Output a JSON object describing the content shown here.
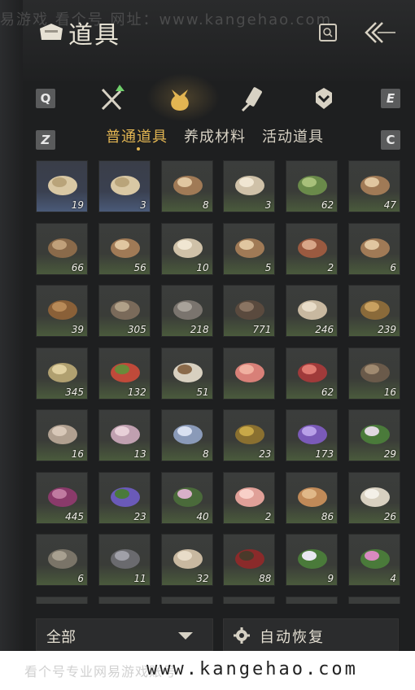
{
  "watermark_top": "易游戏 看个号  网址：www.kangehao.com",
  "header": {
    "title": "道具",
    "search_icon": "search-icon",
    "back_icon": "back-arrow-icon"
  },
  "category_keys": {
    "prev": "Q",
    "next": "E",
    "prev_sub": "Z",
    "next_sub": "C"
  },
  "categories": [
    {
      "icon": "weapons-icon",
      "active": false
    },
    {
      "icon": "pouch-icon",
      "active": true
    },
    {
      "icon": "scroll-brush-icon",
      "active": false
    },
    {
      "icon": "badge-icon",
      "active": false
    }
  ],
  "subtabs": [
    "普通道具",
    "养成材料",
    "活动道具"
  ],
  "active_subtab": 0,
  "items": [
    {
      "name": "scroll",
      "count": "19",
      "style": "blue"
    },
    {
      "name": "scroll",
      "count": "3",
      "style": "blue"
    },
    {
      "name": "logs",
      "count": "8"
    },
    {
      "name": "logs-light",
      "count": "3"
    },
    {
      "name": "bamboo",
      "count": "62"
    },
    {
      "name": "logs",
      "count": "47"
    },
    {
      "name": "branches",
      "count": "66"
    },
    {
      "name": "logs",
      "count": "56"
    },
    {
      "name": "logs-light",
      "count": "10"
    },
    {
      "name": "logs",
      "count": "5"
    },
    {
      "name": "logs-red",
      "count": "2"
    },
    {
      "name": "logs",
      "count": "6"
    },
    {
      "name": "bark",
      "count": "39"
    },
    {
      "name": "logs-dark",
      "count": "305"
    },
    {
      "name": "stone",
      "count": "218"
    },
    {
      "name": "feather",
      "count": "771"
    },
    {
      "name": "mushroom-slices",
      "count": "246"
    },
    {
      "name": "shrimp",
      "count": "239"
    },
    {
      "name": "fish",
      "count": "345"
    },
    {
      "name": "berries",
      "count": "132"
    },
    {
      "name": "mushrooms",
      "count": "51"
    },
    {
      "name": "meat",
      "count": ""
    },
    {
      "name": "meat-slab",
      "count": "62"
    },
    {
      "name": "feathers",
      "count": "16"
    },
    {
      "name": "hide",
      "count": "16"
    },
    {
      "name": "intestine",
      "count": "13"
    },
    {
      "name": "fish-blue",
      "count": "8"
    },
    {
      "name": "ore-gold",
      "count": "23"
    },
    {
      "name": "crystal",
      "count": "173"
    },
    {
      "name": "herb-white",
      "count": "29"
    },
    {
      "name": "flower-purple",
      "count": "445"
    },
    {
      "name": "lavender",
      "count": "23"
    },
    {
      "name": "herb-pink",
      "count": "40"
    },
    {
      "name": "meat-slices",
      "count": "2"
    },
    {
      "name": "fur",
      "count": "86"
    },
    {
      "name": "fur-white",
      "count": "26"
    },
    {
      "name": "stone-fish",
      "count": "6"
    },
    {
      "name": "ore-grey",
      "count": "11"
    },
    {
      "name": "bone",
      "count": "32"
    },
    {
      "name": "red-bush",
      "count": "88"
    },
    {
      "name": "flower-white",
      "count": "9"
    },
    {
      "name": "flower-pink",
      "count": "4"
    }
  ],
  "filter": {
    "label": "全部"
  },
  "auto_restore": {
    "label": "自动恢复"
  },
  "footer": {
    "watermark": "看个号专业网易游戏账号",
    "url": "www.kangehao.com"
  },
  "colors": {
    "accent": "#e2b552",
    "cell_bg": "#3b3d3c",
    "panel_bg": "#1e1f20"
  }
}
